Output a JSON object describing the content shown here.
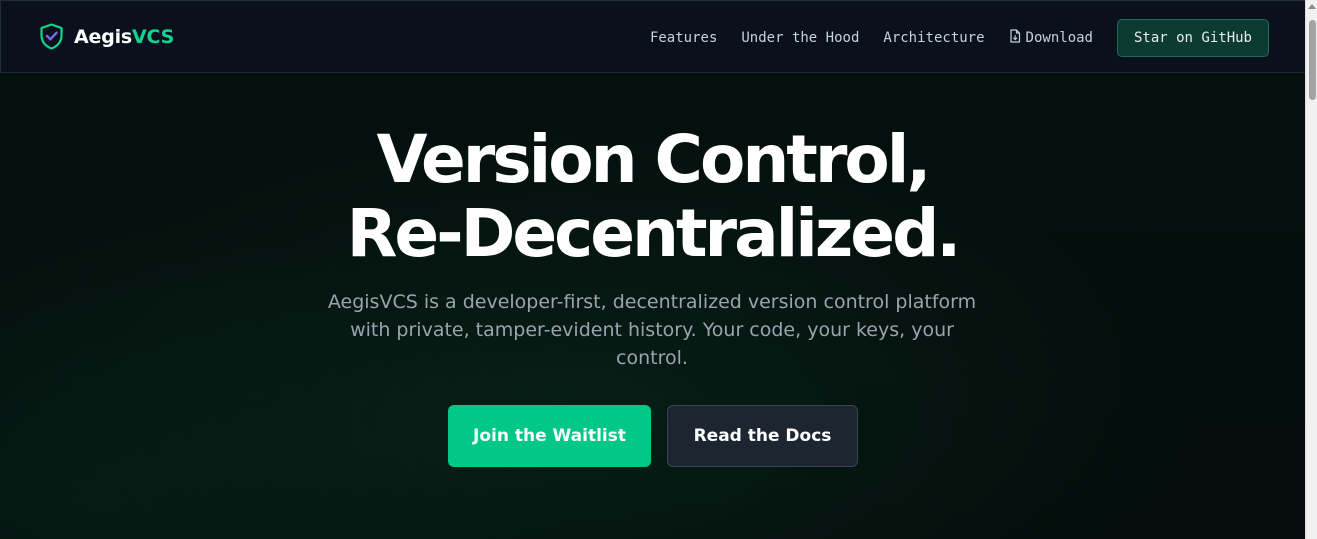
{
  "brand": {
    "name_main": "Aegis",
    "name_accent": "VCS",
    "icon": "shield-check-icon",
    "accent_color": "#10d48e"
  },
  "nav": {
    "links": [
      {
        "label": "Features"
      },
      {
        "label": "Under the Hood"
      },
      {
        "label": "Architecture"
      },
      {
        "label": "Download",
        "icon": "file-download-icon"
      }
    ],
    "github_button": "Star on GitHub"
  },
  "hero": {
    "headline_line1": "Version Control,",
    "headline_line2": "Re-Decentralized.",
    "subtitle": "AegisVCS is a developer-first, decentralized version control platform with private, tamper-evident history. Your code, your keys, your control.",
    "primary_cta": "Join the Waitlist",
    "secondary_cta": "Read the Docs"
  },
  "colors": {
    "primary_button": "#00c887",
    "background": "#040b0a",
    "navbar": "#0a111c"
  }
}
